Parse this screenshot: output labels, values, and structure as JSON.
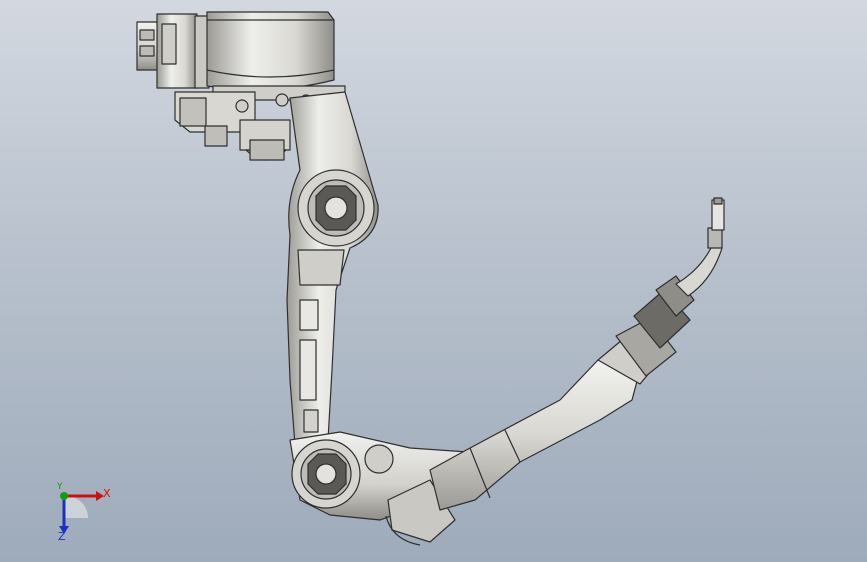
{
  "viewport": {
    "background_top": "#d3d8e0",
    "background_bottom": "#9eabbb",
    "model_fill": "#e3e2de",
    "model_edge": "#2f2f2f",
    "model_shade": "#a9a8a3"
  },
  "triad": {
    "x_label": "X",
    "y_label": "Y",
    "z_label": "Z",
    "x_color": "#d01010",
    "y_color": "#139d13",
    "z_color": "#1d2fbf"
  }
}
